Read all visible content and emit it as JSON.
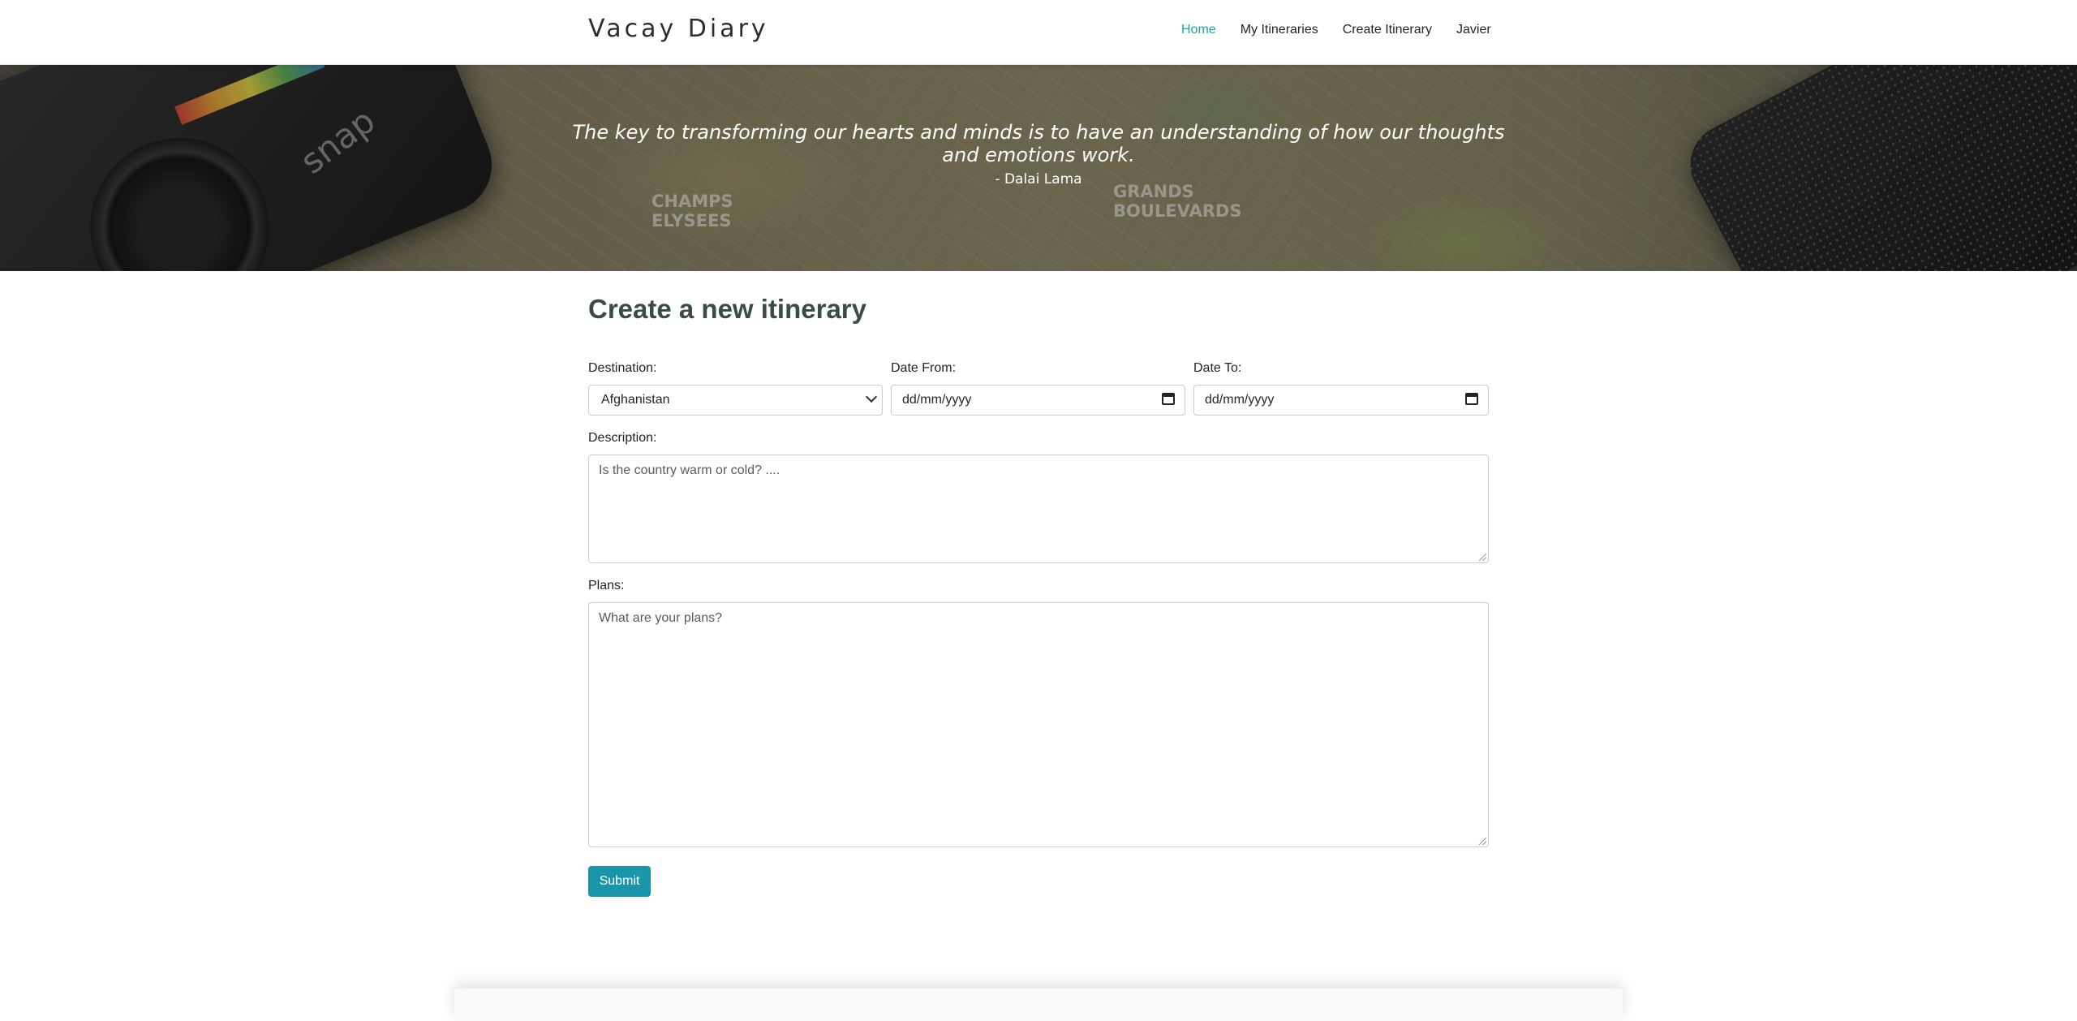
{
  "header": {
    "brand": "Vacay Diary",
    "nav": [
      {
        "label": "Home",
        "active": true
      },
      {
        "label": "My Itineraries",
        "active": false
      },
      {
        "label": "Create Itinerary",
        "active": false
      },
      {
        "label": "Javier",
        "active": false
      }
    ]
  },
  "hero": {
    "quote": "The key to transforming our hearts and minds is to have an understanding of how our thoughts and emotions work.",
    "author": "- Dalai Lama",
    "map_labels": [
      "CHAMPS ELYSEES",
      "GRANDS BOULEVARDS"
    ],
    "camera_label": "snap"
  },
  "form": {
    "title": "Create a new itinerary",
    "destination": {
      "label": "Destination:",
      "value": "Afghanistan"
    },
    "date_from": {
      "label": "Date From:",
      "placeholder": "dd/mm/yyyy"
    },
    "date_to": {
      "label": "Date To:",
      "placeholder": "dd/mm/yyyy"
    },
    "description": {
      "label": "Description:",
      "placeholder": "Is the country warm or cold? ...."
    },
    "plans": {
      "label": "Plans:",
      "placeholder": "What are your plans?"
    },
    "submit_label": "Submit"
  },
  "colors": {
    "accent": "#1aa79a",
    "button": "#1a95aa",
    "heading": "#3b4a4a"
  }
}
